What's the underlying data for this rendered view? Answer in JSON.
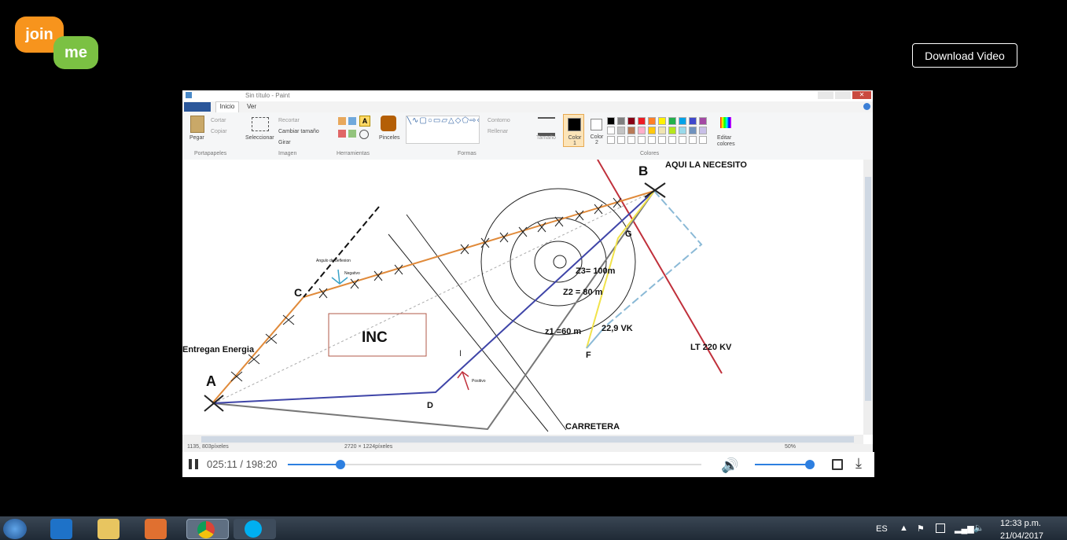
{
  "logo": {
    "word1": "join",
    "word2": "me"
  },
  "download_label": "Download Video",
  "paint": {
    "window_title": "Sin título - Paint",
    "tabs": [
      "Inicio",
      "Ver"
    ],
    "clipboard": {
      "paste": "Pegar",
      "cut": "Cortar",
      "copy": "Copiar",
      "label": "Portapapeles"
    },
    "image": {
      "select": "Seleccionar",
      "crop": "Recortar",
      "resize": "Cambiar tamaño",
      "rotate": "Girar",
      "label": "Imagen"
    },
    "tools_label": "Herramientas",
    "brushes": "Pinceles",
    "shapes": {
      "outline": "Contorno",
      "fill": "Rellenar",
      "label": "Formas"
    },
    "size": "Tamaño",
    "color1": "Color 1",
    "color2": "Color 2",
    "edit_colors": "Editar colores",
    "colors_label": "Colores",
    "status": {
      "pos": "1135, 803píxeles",
      "size": "2720 × 1224píxeles",
      "zoom": "50%"
    }
  },
  "drawing": {
    "point_a": "A",
    "point_b": "B",
    "point_c": "C",
    "point_d": "D",
    "point_f": "F",
    "point_g": "G",
    "need_here": "AQUI LA NECESITO",
    "deliver": "Entregan Energia",
    "inc": "INC",
    "z3": "Z3= 100m",
    "z2": "Z2 = 80 m",
    "z1": "z1 =60 m",
    "vk": "22,9 VK",
    "lt": "LT 220 KV",
    "road": "CARRETERA",
    "deflection": "Angulo de deflexion",
    "negative": "Negativo",
    "positive": "Positivo"
  },
  "player": {
    "time": "025:11 / 198:20",
    "progress": 0.127,
    "volume": 1.0
  },
  "taskbar": {
    "lang": "ES",
    "time": "12:33 p.m.",
    "date": "21/04/2017"
  },
  "colors": {
    "orange": "#f7941d",
    "green": "#7bc143",
    "player_blue": "#2d7fe0"
  }
}
